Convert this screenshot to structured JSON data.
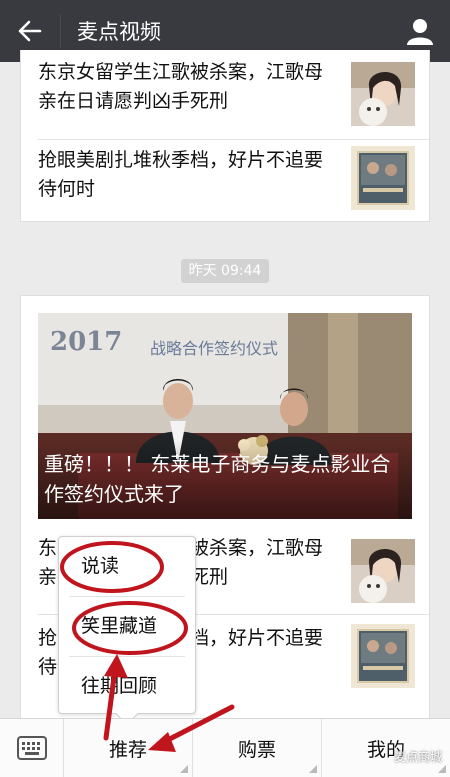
{
  "header": {
    "title": "麦点视频"
  },
  "top_card": {
    "items": [
      {
        "text": "东京女留学生江歌被杀案，江歌母亲在日请愿判凶手死刑"
      },
      {
        "text": "抢眼美剧扎堆秋季档，好片不追要待何时"
      }
    ]
  },
  "timestamp": "昨天 09:44",
  "feature_card": {
    "hero_title": "重磅！！！ 东莱电子商务与麦点影业合作签约仪式来了",
    "hero_banner_year": "2017",
    "hero_banner_text": "战略合作签约仪式",
    "items": [
      {
        "text": "东京女留学生江歌被杀案，江歌母亲在日请愿判凶手死刑"
      },
      {
        "text": "抢眼美剧扎堆秋季档，好片不追要待何时"
      }
    ]
  },
  "popup_menu": {
    "items": [
      "说读",
      "笑里藏道",
      "往期回顾"
    ]
  },
  "bottom_menu": {
    "items": [
      "推荐",
      "购票",
      "我的"
    ]
  },
  "watermark": "麦点商城",
  "colors": {
    "topbar": "#393a3f",
    "annotation": "#c0151d"
  }
}
